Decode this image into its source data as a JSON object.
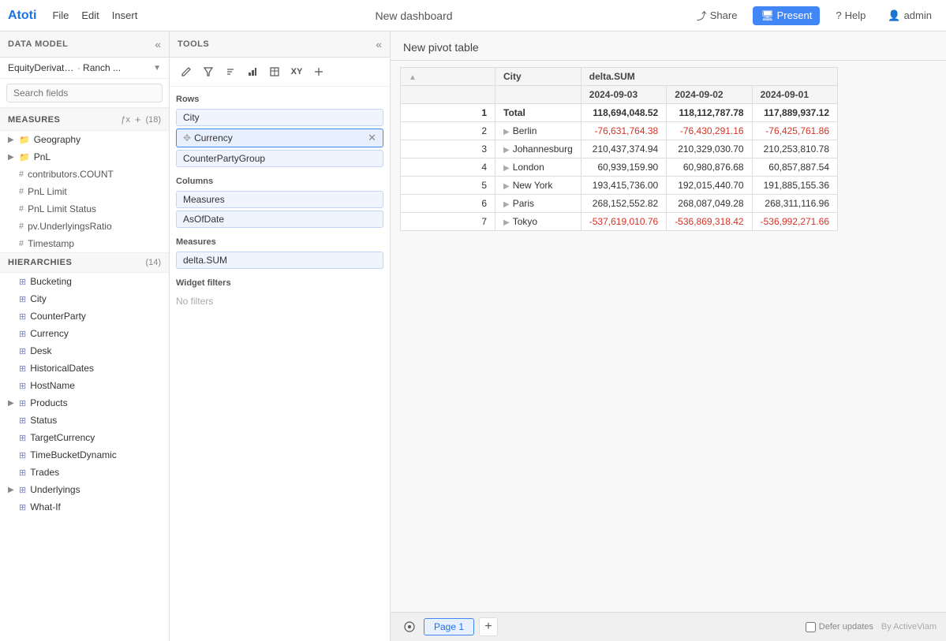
{
  "topbar": {
    "logo": "Atoti",
    "menu": [
      "File",
      "Edit",
      "Insert"
    ],
    "title": "New dashboard",
    "share": "Share",
    "present": "Present",
    "help": "Help",
    "user": "admin"
  },
  "left_panel": {
    "header": "DATA MODEL",
    "cube_name": "EquityDerivativesCube",
    "cube_suffix": "Ranch ...",
    "search_placeholder": "Search fields",
    "measures_title": "MEASURES",
    "measures_count": "(18)",
    "measures": [
      {
        "label": "Geography",
        "type": "folder",
        "expandable": true
      },
      {
        "label": "PnL",
        "type": "folder",
        "expandable": true
      },
      {
        "label": "contributors.COUNT",
        "type": "hash"
      },
      {
        "label": "PnL Limit",
        "type": "hash"
      },
      {
        "label": "PnL Limit Status",
        "type": "hash"
      },
      {
        "label": "pv.UnderlyingsRatio",
        "type": "hash"
      },
      {
        "label": "Timestamp",
        "type": "hash"
      }
    ],
    "hierarchies_title": "HIERARCHIES",
    "hierarchies_count": "(14)",
    "hierarchies": [
      {
        "label": "Bucketing",
        "type": "folder",
        "expandable": false
      },
      {
        "label": "City",
        "type": "hier"
      },
      {
        "label": "CounterParty",
        "type": "hier"
      },
      {
        "label": "Currency",
        "type": "hier"
      },
      {
        "label": "Desk",
        "type": "hier"
      },
      {
        "label": "HistoricalDates",
        "type": "hier"
      },
      {
        "label": "HostName",
        "type": "hier"
      },
      {
        "label": "Products",
        "type": "hier",
        "expandable": true
      },
      {
        "label": "Status",
        "type": "hier"
      },
      {
        "label": "TargetCurrency",
        "type": "hier"
      },
      {
        "label": "TimeBucketDynamic",
        "type": "hier"
      },
      {
        "label": "Trades",
        "type": "hier"
      },
      {
        "label": "Underlyings",
        "type": "hier",
        "expandable": true
      },
      {
        "label": "What-If",
        "type": "hier"
      }
    ]
  },
  "tools_panel": {
    "header": "TOOLS",
    "toolbar": [
      "pencil",
      "filter",
      "arrow-down-filter",
      "bar-chart",
      "rectangle",
      "xy",
      "arrow-in"
    ],
    "rows_label": "Rows",
    "rows_fields": [
      {
        "label": "City"
      },
      {
        "label": "Currency",
        "removable": true
      },
      {
        "label": "CounterPartyGroup"
      }
    ],
    "columns_label": "Columns",
    "columns_fields": [
      {
        "label": "Measures"
      },
      {
        "label": "AsOfDate"
      }
    ],
    "measures_label": "Measures",
    "measures_fields": [
      {
        "label": "delta.SUM"
      }
    ],
    "widget_filters_label": "Widget filters",
    "no_filters": "No filters"
  },
  "pivot": {
    "title": "New pivot table",
    "col_headers": {
      "city": "City",
      "delta_sum": "delta.SUM",
      "date1": "2024-09-03",
      "date2": "2024-09-02",
      "date3": "2024-09-01"
    },
    "rows": [
      {
        "num": 1,
        "label": "Total",
        "expandable": false,
        "values": [
          "118,694,048.52",
          "118,112,787.78",
          "117,889,937.12"
        ],
        "negatives": [
          false,
          false,
          false
        ]
      },
      {
        "num": 2,
        "label": "Berlin",
        "expandable": true,
        "values": [
          "-76,631,764.38",
          "-76,430,291.16",
          "-76,425,761.86"
        ],
        "negatives": [
          true,
          true,
          true
        ]
      },
      {
        "num": 3,
        "label": "Johannesburg",
        "expandable": true,
        "values": [
          "210,437,374.94",
          "210,329,030.70",
          "210,253,810.78"
        ],
        "negatives": [
          false,
          false,
          false
        ]
      },
      {
        "num": 4,
        "label": "London",
        "expandable": true,
        "values": [
          "60,939,159.90",
          "60,980,876.68",
          "60,857,887.54"
        ],
        "negatives": [
          false,
          false,
          false
        ]
      },
      {
        "num": 5,
        "label": "New York",
        "expandable": true,
        "values": [
          "193,415,736.00",
          "192,015,440.70",
          "191,885,155.36"
        ],
        "negatives": [
          false,
          false,
          false
        ]
      },
      {
        "num": 6,
        "label": "Paris",
        "expandable": true,
        "values": [
          "268,152,552.82",
          "268,087,049.28",
          "268,311,116.96"
        ],
        "negatives": [
          false,
          false,
          false
        ]
      },
      {
        "num": 7,
        "label": "Tokyo",
        "expandable": true,
        "values": [
          "-537,619,010.76",
          "-536,869,318.42",
          "-536,992,271.66"
        ],
        "negatives": [
          true,
          true,
          true
        ]
      }
    ],
    "page_label": "Page 1"
  }
}
